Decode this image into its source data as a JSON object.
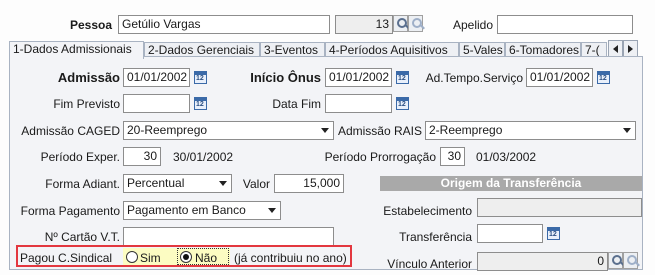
{
  "header": {
    "pessoa_label": "Pessoa",
    "pessoa_value": "Getúlio Vargas",
    "code_value": "13",
    "apelido_label": "Apelido",
    "apelido_value": ""
  },
  "tabs": [
    {
      "label": "1-Dados Admissionais",
      "active": true
    },
    {
      "label": "2-Dados Gerenciais"
    },
    {
      "label": "3-Eventos"
    },
    {
      "label": "4-Períodos Aquisitivos"
    },
    {
      "label": "5-Vales"
    },
    {
      "label": "6-Tomadores"
    },
    {
      "label": "7-("
    }
  ],
  "form": {
    "admissao_label": "Admissão",
    "admissao_value": "01/01/2002",
    "inicio_onus_label": "Início Ônus",
    "inicio_onus_value": "01/01/2002",
    "ad_tempo_label": "Ad.Tempo.Serviço",
    "ad_tempo_value": "01/01/2002",
    "fim_previsto_label": "Fim Previsto",
    "fim_previsto_value": "",
    "data_fim_label": "Data Fim",
    "data_fim_value": "",
    "admissao_caged_label": "Admissão CAGED",
    "admissao_caged_value": "20-Reemprego",
    "admissao_rais_label": "Admissão RAIS",
    "admissao_rais_value": "2-Reemprego",
    "periodo_exper_label": "Período Exper.",
    "periodo_exper_value": "30",
    "periodo_exper_date": "30/01/2002",
    "periodo_prorrog_label": "Período Prorrogação",
    "periodo_prorrog_value": "30",
    "periodo_prorrog_date": "01/03/2002",
    "forma_adiant_label": "Forma Adiant.",
    "forma_adiant_value": "Percentual",
    "valor_label": "Valor",
    "valor_value": "15,000",
    "origem_header": "Origem da Transferência",
    "forma_pagamento_label": "Forma Pagamento",
    "forma_pagamento_value": "Pagamento em Banco",
    "estabelecimento_label": "Estabelecimento",
    "estabelecimento_value": "",
    "cartao_vt_label": "Nº Cartão V.T.",
    "cartao_vt_value": "",
    "transferencia_label": "Transferência",
    "transferencia_value": "",
    "pagou_label": "Pagou C.Sindical",
    "sim_label": "Sim",
    "nao_label": "Não",
    "pagou_note": "(já contribuiu no ano)",
    "vinculo_label": "Vínculo Anterior",
    "vinculo_value": "0",
    "calendar_glyph": "12",
    "pagou_selected": "Não"
  },
  "colors": {
    "highlight_border": "#e3373f",
    "section_header_bg": "#a9a9a9",
    "yellow_field": "#fcfcc2"
  }
}
